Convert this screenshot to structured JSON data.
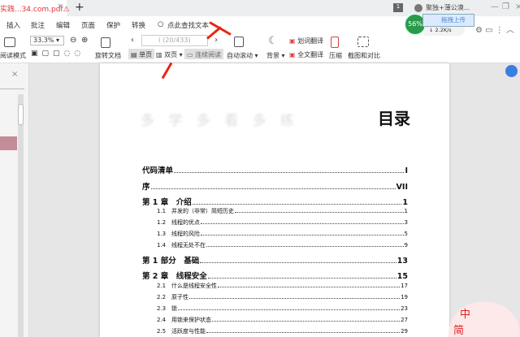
{
  "tab": {
    "title": "实践...34.com.pdf",
    "warn": "⚠",
    "close": "×"
  },
  "newtab": "+",
  "topright": {
    "badge": "1",
    "user": "聚独+薄公漠...",
    "min": "—",
    "max": "❐",
    "close": "×"
  },
  "menu": [
    "插入",
    "批注",
    "编辑",
    "页面",
    "保护",
    "转换"
  ],
  "search": "点此查找文本",
  "toolbar": {
    "read_mode": "阅读模式",
    "zoom": "33.3%",
    "rotate": "旋转文档",
    "page_input": "i (20/433)",
    "single": "单页",
    "double": "双页",
    "continuous": "连续阅读",
    "autoscroll": "自动滚动",
    "background": "背景",
    "word_translate": "划词翻译",
    "full_translate": "全文翻译",
    "compress": "压缩",
    "screenshot": "截图和对比"
  },
  "float": {
    "percent": "56%",
    "upload": "拖拽上传",
    "speed": "2.2K/s"
  },
  "document": {
    "title": "目录",
    "watermark": "多学多看多练",
    "toc": [
      {
        "label": "代码清单",
        "page": "I",
        "level": 1
      },
      {
        "label": "序",
        "page": "VII",
        "level": 1
      },
      {
        "label": "第 1 章　介绍",
        "page": "1",
        "level": 1
      },
      {
        "num": "1.1",
        "label": "并发的（非常）简短历史",
        "page": "1",
        "level": 2
      },
      {
        "num": "1.2",
        "label": "线程的优点",
        "page": "3",
        "level": 2
      },
      {
        "num": "1.3",
        "label": "线程的风险",
        "page": "5",
        "level": 2
      },
      {
        "num": "1.4",
        "label": "线程无处不在",
        "page": "9",
        "level": 2
      },
      {
        "label": "第 1 部分　基础",
        "page": "13",
        "level": 1
      },
      {
        "label": "第 2 章　线程安全",
        "page": "15",
        "level": 1
      },
      {
        "num": "2.1",
        "label": "什么是线程安全性",
        "page": "17",
        "level": 2
      },
      {
        "num": "2.2",
        "label": "原子性",
        "page": "19",
        "level": 2
      },
      {
        "num": "2.3",
        "label": "锁",
        "page": "23",
        "level": 2
      },
      {
        "num": "2.4",
        "label": "用锁来保护状态",
        "page": "27",
        "level": 2
      },
      {
        "num": "2.5",
        "label": "活跃度与性能",
        "page": "29",
        "level": 2
      }
    ]
  },
  "mascot": {
    "line1": "中",
    "line2": "简"
  }
}
